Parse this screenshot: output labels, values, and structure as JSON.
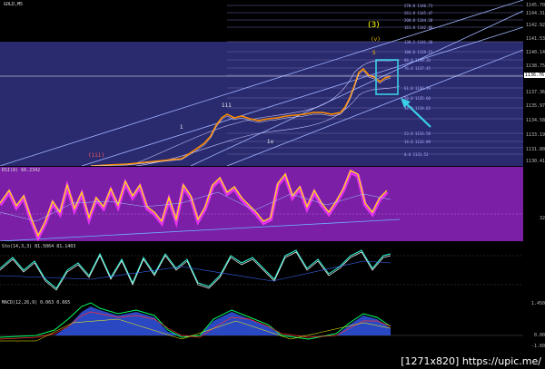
{
  "chart": {
    "symbol_label": "GOLD,M5",
    "wave_label_3": "(3)",
    "wave_label_v": "(v)",
    "wave_label_5": "5",
    "wave_label_iii": "(iii)",
    "wave_label_i": "i",
    "wave_label_ii": "iii",
    "wave_label_iv": "iv",
    "price_scale": [
      "1145.70",
      "1144.31",
      "1142.92",
      "1141.53",
      "1140.14",
      "1138.75",
      "1137.36",
      "1135.97",
      "1134.58",
      "1133.19",
      "1131.80",
      "1130.41"
    ],
    "current_price": "1136.76"
  },
  "rsi": {
    "label": "RSI(8) 66.2342",
    "level_left": "32"
  },
  "stoch": {
    "label": "Sto(14,3,3) 81.5064 81.1403"
  },
  "macd": {
    "label": "MACD(12,26,9) 0.063 0.665",
    "scale_top": "1.450",
    "scale_mid": "0.00",
    "scale_bot": "-1.60"
  },
  "footer": {
    "text": "[1271x820] https://upic.me/"
  },
  "colors": {
    "main_bg": "#2a2a6e",
    "rsi_bg": "#7a1fa6",
    "accent_cyan": "#3ad0e8",
    "rsi_line": "#ffe600",
    "rsi_band": "#ff38ff",
    "wave_yellow": "#ffff00"
  }
}
